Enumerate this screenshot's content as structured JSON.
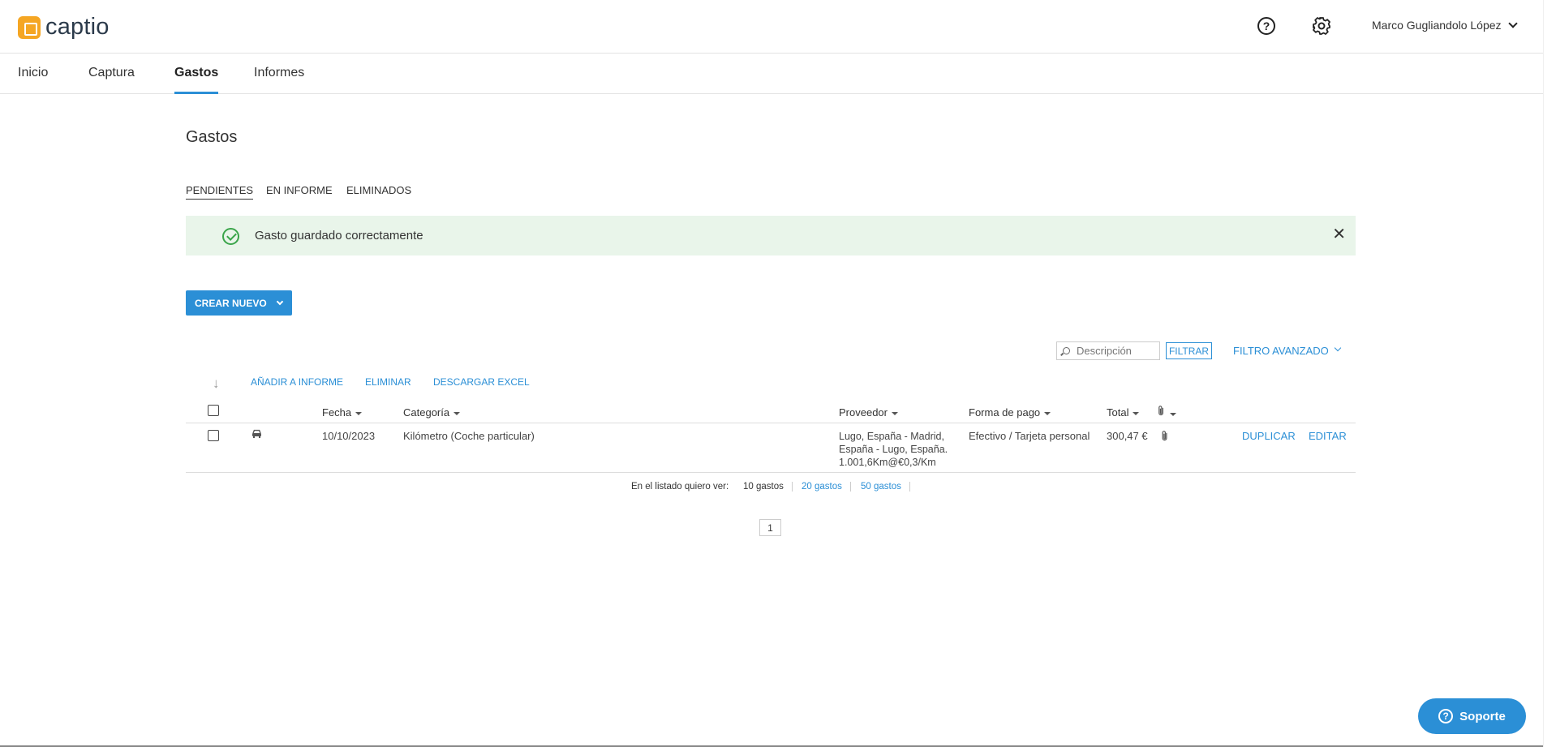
{
  "brand": {
    "name": "captio",
    "color": "#f5a623"
  },
  "header": {
    "help_icon": "help-icon",
    "settings_icon": "gear-icon",
    "user_name": "Marco Gugliandolo López"
  },
  "nav": {
    "items": [
      "Inicio",
      "Captura",
      "Gastos",
      "Informes"
    ],
    "active": "Gastos"
  },
  "page": {
    "title": "Gastos"
  },
  "subtabs": {
    "items": [
      "PENDIENTES",
      "EN INFORME",
      "ELIMINADOS"
    ],
    "active": "PENDIENTES"
  },
  "alert": {
    "message": "Gasto guardado correctamente",
    "close": "✕",
    "color": "#3aa54a"
  },
  "create_button": {
    "label": "CREAR NUEVO"
  },
  "filter": {
    "placeholder": "Descripción",
    "filter_label": "FILTRAR",
    "advanced_label": "FILTRO AVANZADO"
  },
  "actions": {
    "add_report": "AÑADIR A INFORME",
    "delete": "ELIMINAR",
    "download_excel": "DESCARGAR EXCEL"
  },
  "table": {
    "columns": {
      "date": "Fecha",
      "category": "Categoría",
      "provider": "Proveedor",
      "payment": "Forma de pago",
      "total": "Total"
    },
    "rows": [
      {
        "date": "10/10/2023",
        "category": "Kilómetro (Coche particular)",
        "provider_lines": [
          "Lugo, España - Madrid,",
          "España - Lugo, España.",
          "1.001,6Km@€0,3/Km"
        ],
        "payment": "Efectivo / Tarjeta personal",
        "total": "300,47 €",
        "duplicate": "DUPLICAR",
        "edit": "EDITAR"
      }
    ]
  },
  "pagination": {
    "label": "En el listado quiero ver:",
    "options": [
      "10 gastos",
      "20 gastos",
      "50 gastos"
    ],
    "selected": "10 gastos",
    "current_page": "1"
  },
  "support": {
    "label": "Soporte"
  },
  "colors": {
    "accent": "#2b8fd6"
  }
}
